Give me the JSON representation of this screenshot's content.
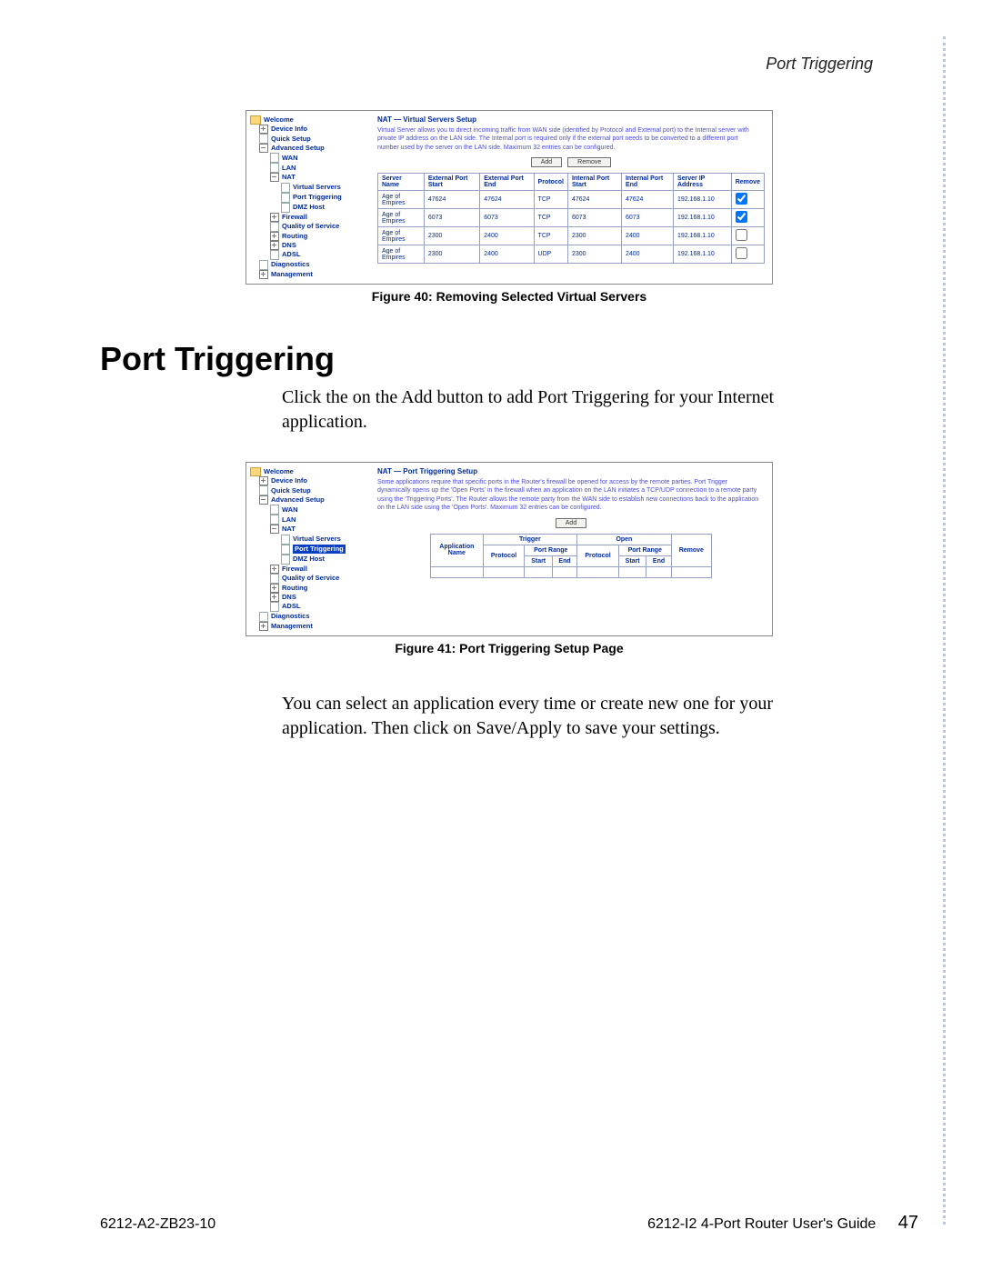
{
  "page_header": "Port Triggering",
  "fig40": {
    "caption": "Figure 40: Removing Selected Virtual Servers",
    "nav_items": [
      {
        "label": "Welcome",
        "depth": 0,
        "kind": "folder"
      },
      {
        "label": "Device Info",
        "depth": 1,
        "kind": "node"
      },
      {
        "label": "Quick Setup",
        "depth": 1,
        "kind": "page"
      },
      {
        "label": "Advanced Setup",
        "depth": 1,
        "kind": "open"
      },
      {
        "label": "WAN",
        "depth": 2,
        "kind": "page"
      },
      {
        "label": "LAN",
        "depth": 2,
        "kind": "page"
      },
      {
        "label": "NAT",
        "depth": 2,
        "kind": "open"
      },
      {
        "label": "Virtual Servers",
        "depth": 3,
        "kind": "page"
      },
      {
        "label": "Port Triggering",
        "depth": 3,
        "kind": "page"
      },
      {
        "label": "DMZ Host",
        "depth": 3,
        "kind": "page"
      },
      {
        "label": "Firewall",
        "depth": 2,
        "kind": "node"
      },
      {
        "label": "Quality of Service",
        "depth": 2,
        "kind": "page"
      },
      {
        "label": "Routing",
        "depth": 2,
        "kind": "node"
      },
      {
        "label": "DNS",
        "depth": 2,
        "kind": "node"
      },
      {
        "label": "ADSL",
        "depth": 2,
        "kind": "page"
      },
      {
        "label": "Diagnostics",
        "depth": 1,
        "kind": "page"
      },
      {
        "label": "Management",
        "depth": 1,
        "kind": "node"
      }
    ],
    "panel_title": "NAT — Virtual Servers Setup",
    "panel_desc": "Virtual Server allows you to direct incoming traffic from WAN side (identified by Protocol and External port) to the Internal server with private IP address on the LAN side. The Internal port is required only if the external port needs to be converted to a different port number used by the server on the LAN side. Maximum 32 entries can be configured.",
    "btn_add": "Add",
    "btn_remove": "Remove",
    "th": [
      "Server Name",
      "External Port Start",
      "External Port End",
      "Protocol",
      "Internal Port Start",
      "Internal Port End",
      "Server IP Address",
      "Remove"
    ],
    "rows": [
      {
        "name": "Age of Empires",
        "eps": "47624",
        "epe": "47624",
        "proto": "TCP",
        "ips": "47624",
        "ipe": "47624",
        "ip": "192.168.1.10",
        "chk": true
      },
      {
        "name": "Age of Empires",
        "eps": "6073",
        "epe": "6073",
        "proto": "TCP",
        "ips": "6073",
        "ipe": "6073",
        "ip": "192.168.1.10",
        "chk": true
      },
      {
        "name": "Age of Empires",
        "eps": "2300",
        "epe": "2400",
        "proto": "TCP",
        "ips": "2300",
        "ipe": "2400",
        "ip": "192.168.1.10",
        "chk": false
      },
      {
        "name": "Age of Empires",
        "eps": "2300",
        "epe": "2400",
        "proto": "UDP",
        "ips": "2300",
        "ipe": "2400",
        "ip": "192.168.1.10",
        "chk": false
      }
    ]
  },
  "section_title": "Port Triggering",
  "para1": "Click the on the Add button to add Port Triggering for your Internet application.",
  "fig41": {
    "caption": "Figure 41: Port Triggering Setup Page",
    "nav_items": [
      {
        "label": "Welcome",
        "depth": 0,
        "kind": "folder"
      },
      {
        "label": "Device Info",
        "depth": 1,
        "kind": "node"
      },
      {
        "label": "Quick Setup",
        "depth": 1,
        "kind": "page"
      },
      {
        "label": "Advanced Setup",
        "depth": 1,
        "kind": "open"
      },
      {
        "label": "WAN",
        "depth": 2,
        "kind": "page"
      },
      {
        "label": "LAN",
        "depth": 2,
        "kind": "page"
      },
      {
        "label": "NAT",
        "depth": 2,
        "kind": "open"
      },
      {
        "label": "Virtual Servers",
        "depth": 3,
        "kind": "page"
      },
      {
        "label": "Port Triggering",
        "depth": 3,
        "kind": "page",
        "selected": true
      },
      {
        "label": "DMZ Host",
        "depth": 3,
        "kind": "page"
      },
      {
        "label": "Firewall",
        "depth": 2,
        "kind": "node"
      },
      {
        "label": "Quality of Service",
        "depth": 2,
        "kind": "page"
      },
      {
        "label": "Routing",
        "depth": 2,
        "kind": "node"
      },
      {
        "label": "DNS",
        "depth": 2,
        "kind": "node"
      },
      {
        "label": "ADSL",
        "depth": 2,
        "kind": "page"
      },
      {
        "label": "Diagnostics",
        "depth": 1,
        "kind": "page"
      },
      {
        "label": "Management",
        "depth": 1,
        "kind": "node"
      }
    ],
    "panel_title": "NAT — Port Triggering Setup",
    "panel_desc": "Some applications require that specific ports in the Router's firewall be opened for access by the remote parties. Port Trigger dynamically opens up the 'Open Ports' in the firewall when an application on the LAN initiates a TCP/UDP connection to a remote party using the 'Triggering Ports'. The Router allows the remote party from the WAN side to establish new connections back to the application on the LAN side using the 'Open Ports'. Maximum 32 entries can be configured.",
    "btn_add": "Add",
    "th_app": "Application",
    "th_trigger": "Trigger",
    "th_open": "Open",
    "th_remove": "Remove",
    "th_name": "Name",
    "th_proto": "Protocol",
    "th_range": "Port Range",
    "th_start": "Start",
    "th_end": "End"
  },
  "para2": "You can select an application every time or create new one for your application. Then click on Save/Apply to save your settings.",
  "footer_left": "6212-A2-ZB23-10",
  "footer_right": "6212-I2 4-Port Router User's Guide",
  "footer_page": "47"
}
